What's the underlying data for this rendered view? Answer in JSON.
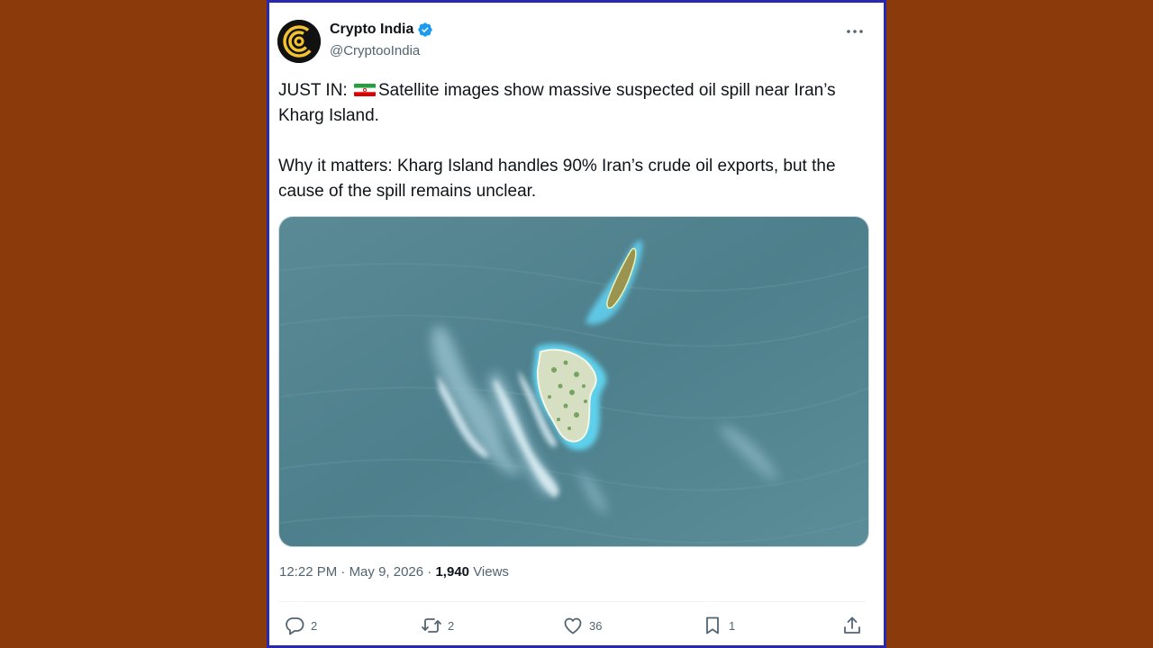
{
  "author": {
    "name": "Crypto India",
    "handle": "@CryptooIndia",
    "avatar_icon": "crypto-india-logo",
    "verified_icon": "verified-badge-icon"
  },
  "tweet": {
    "paragraph1_prefix": "JUST IN:",
    "flag_icon": "iran-flag-icon",
    "paragraph1_text": "Satellite images show massive suspected oil spill near Iran’s Kharg Island.",
    "paragraph2": "Why it matters: Kharg Island handles 90% Iran’s crude oil exports, but the cause of the spill remains unclear."
  },
  "meta": {
    "time": "12:22 PM",
    "separator": "·",
    "date": "May 9, 2026",
    "views_count": "1,940",
    "views_label": "Views"
  },
  "actions": {
    "replies": "2",
    "reposts": "2",
    "likes": "36",
    "bookmarks": "1"
  },
  "colors": {
    "background": "#8b3a0b",
    "card_border": "#2a27b0",
    "verified": "#1d9bf0",
    "text_secondary": "#536471"
  }
}
